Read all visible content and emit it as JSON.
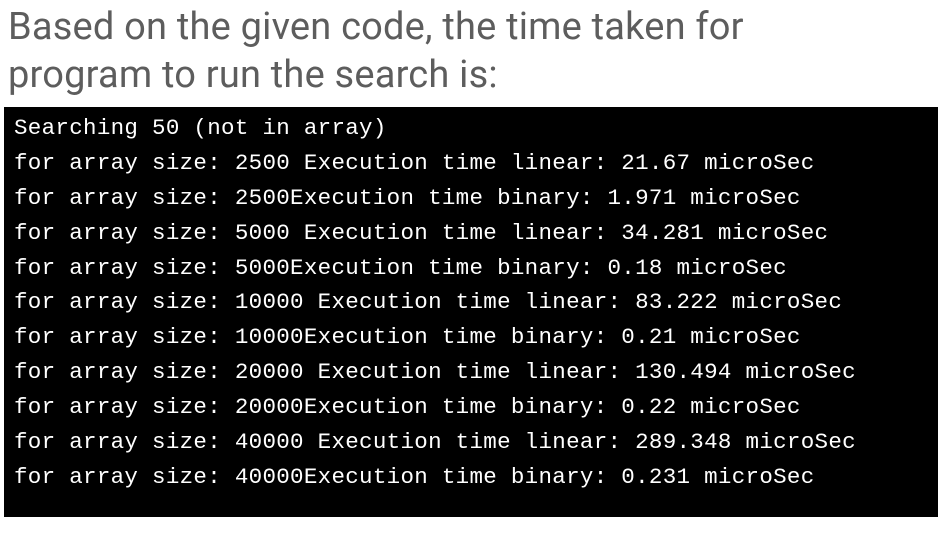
{
  "heading": {
    "line1": "Based on the given code, the time taken for",
    "line2": "program to run the search is:"
  },
  "terminal": {
    "title": "Searching 50 (not in array)",
    "rows": [
      {
        "size": "2500",
        "type": "linear",
        "time": "21.67",
        "space_after_size": true
      },
      {
        "size": "2500",
        "type": "binary",
        "time": "1.971",
        "space_after_size": false
      },
      {
        "size": "5000",
        "type": "linear",
        "time": "34.281",
        "space_after_size": true
      },
      {
        "size": "5000",
        "type": "binary",
        "time": "0.18",
        "space_after_size": false
      },
      {
        "size": "10000",
        "type": "linear",
        "time": "83.222",
        "space_after_size": true
      },
      {
        "size": "10000",
        "type": "binary",
        "time": "0.21",
        "space_after_size": false
      },
      {
        "size": "20000",
        "type": "linear",
        "time": "130.494",
        "space_after_size": true
      },
      {
        "size": "20000",
        "type": "binary",
        "time": "0.22",
        "space_after_size": false
      },
      {
        "size": "40000",
        "type": "linear",
        "time": "289.348",
        "space_after_size": true
      },
      {
        "size": "40000",
        "type": "binary",
        "time": "0.231",
        "space_after_size": false
      }
    ],
    "prefix": "for array size: ",
    "exec_label": "Execution time ",
    "unit": " microSec"
  }
}
